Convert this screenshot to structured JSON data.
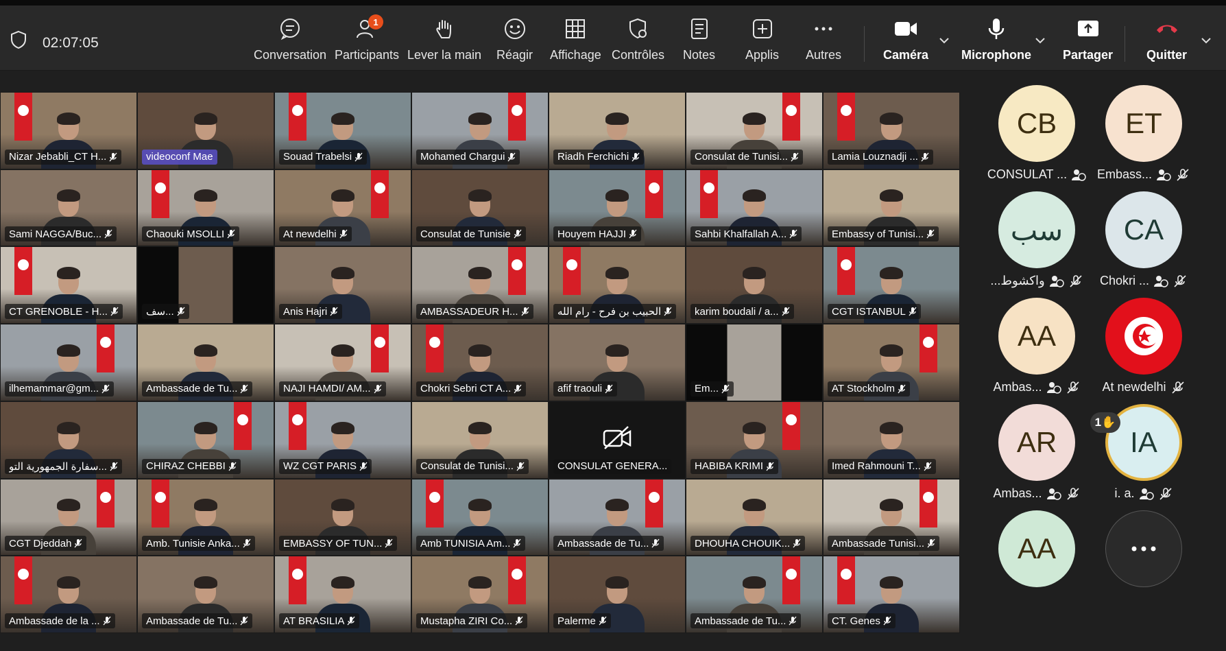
{
  "timer": "02:07:05",
  "toolbar": [
    {
      "label": "Conversation",
      "icon": "chat-icon"
    },
    {
      "label": "Participants",
      "icon": "people-icon",
      "badge": "1"
    },
    {
      "label": "Lever la main",
      "icon": "hand-icon"
    },
    {
      "label": "Réagir",
      "icon": "smile-icon"
    },
    {
      "label": "Affichage",
      "icon": "grid-icon"
    },
    {
      "label": "Contrôles",
      "icon": "shield-gear-icon"
    },
    {
      "label": "Notes",
      "icon": "notes-icon"
    },
    {
      "label": "Applis",
      "icon": "plus-square-icon"
    },
    {
      "label": "Autres",
      "icon": "more-icon"
    },
    {
      "label": "Caméra",
      "icon": "camera-icon"
    },
    {
      "label": "Microphone",
      "icon": "mic-icon"
    },
    {
      "label": "Partager",
      "icon": "share-icon"
    },
    {
      "label": "Quitter",
      "icon": "hangup-icon"
    }
  ],
  "tiles": [
    "Nizar Jebabli_CT H...",
    "videoconf Mae",
    "Souad Trabelsi",
    "Mohamed Chargui",
    "Riadh Ferchichi",
    "Consulat de Tunisi...",
    "Lamia Louznadji ...",
    "Sami NAGGA/Buc...",
    "Chaouki MSOLLI",
    "At newdelhi",
    "Consulat de Tunisie",
    "Houyem HAJJI",
    "Sahbi Khalfallah A...",
    "Embassy of Tunisi...",
    "CT GRENOBLE - H...",
    "سف...",
    "Anis Hajri",
    "AMBASSADEUR H...",
    "الحبيب بن فرح - رام الله",
    "karim boudali / a...",
    "CGT ISTANBUL",
    "ilhemammar@gm...",
    "Ambassade de Tu...",
    "NAJI HAMDI/ AM...",
    "Chokri Sebri CT A...",
    "afif traouli",
    "Em...",
    "AT Stockholm",
    "سفارة الجمهورية التو...",
    "CHIRAZ CHEBBI",
    "WZ CGT PARIS",
    "Consulat de Tunisi...",
    "CONSULAT GENERA...",
    "HABIBA KRIMI",
    "Imed Rahmouni T...",
    "CGT Djeddah",
    "Amb. Tunisie Anka...",
    "EMBASSY OF TUN...",
    "Amb TUNISIA Am...",
    "Ambassade de Tu...",
    "DHOUHA CHOUIK...",
    "Ambassade Tunisi...",
    "Ambassade de la ...",
    "Ambassade de Tu...",
    "AT BRASILIA",
    "Mustapha ZIRI Co...",
    "Palerme",
    "Ambassade de Tu...",
    "CT. Genes"
  ],
  "avatars": [
    {
      "initials": "CB",
      "name": "CONSULAT ...",
      "color": "#f7e9c3"
    },
    {
      "initials": "ET",
      "name": "Embass...",
      "color": "#f7e2cf"
    },
    {
      "initials": "سب",
      "name": "...واكشوط",
      "color": "#d6ebe0"
    },
    {
      "initials": "CA",
      "name": "Chokri ...",
      "color": "#dce6ea"
    },
    {
      "initials": "AA",
      "name": "Ambas...",
      "color": "#f7e2c4"
    },
    {
      "initials": "",
      "name": "At newdelhi",
      "color": "#e2101b"
    },
    {
      "initials": "AR",
      "name": "Ambas...",
      "color": "#f2dcd8"
    },
    {
      "initials": "IA",
      "name": "i. a.",
      "color": "#d9eef0",
      "raise": "1"
    },
    {
      "initials": "AA",
      "name": "",
      "color": "#cfe9d6"
    },
    {
      "initials": "•••",
      "name": "",
      "color": "#2a2a2a"
    }
  ]
}
